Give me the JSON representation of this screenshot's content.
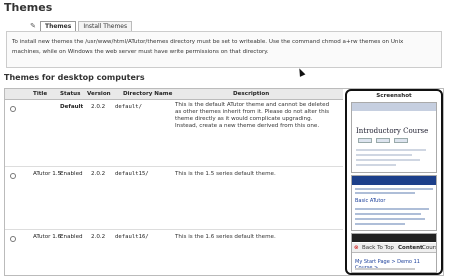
{
  "page_title": "Themes",
  "tabs": [
    {
      "label": "Themes",
      "active": true
    },
    {
      "label": "Install Themes",
      "active": false
    }
  ],
  "notice": {
    "line1": "To install new themes the /usr/www/html/ATutor/themes directory must be set to writeable. Use the command chmod  a+rw  themes on Unix",
    "line2": "machines, while on Windows the web server must have write permissions on that directory."
  },
  "section_title": "Themes for desktop computers",
  "table": {
    "headers": {
      "title": "Title",
      "status": "Status",
      "version": "Version",
      "directory": "Directory Name",
      "description": "Description",
      "screenshot": "Screenshot"
    },
    "rows": [
      {
        "title": "",
        "status": "Default",
        "version": "2.0.2",
        "directory": "default/",
        "description": "This is the default ATutor theme and cannot be deleted as other themes inherit from it. Please do not alter this theme directly as it would complicate upgrading. Instead, create a new theme derived from this one."
      },
      {
        "title": "ATutor 1.5",
        "status": "Enabled",
        "version": "2.0.2",
        "directory": "default15/",
        "description": "This is the 1.5 series default theme."
      },
      {
        "title": "ATutor 1.6",
        "status": "Enabled",
        "version": "2.0.2",
        "directory": "default16/",
        "description": "This is the 1.6 series default theme."
      }
    ]
  },
  "thumbnails": {
    "thumb1": {
      "heading": "Introductory Course"
    },
    "thumb2": {
      "link": "Basic ATutor"
    },
    "thumb3": {
      "back_label": "Back To Top",
      "content_label": "Content",
      "course_label": "Course",
      "crumbs": "My Start Page > Demo 11 Course >"
    }
  },
  "colors": {
    "notice_bg": "#fafafa",
    "header_bg": "#e9e9e9",
    "thumb2_bar": "#1c3f8a",
    "thumb3_bar": "#222222"
  }
}
